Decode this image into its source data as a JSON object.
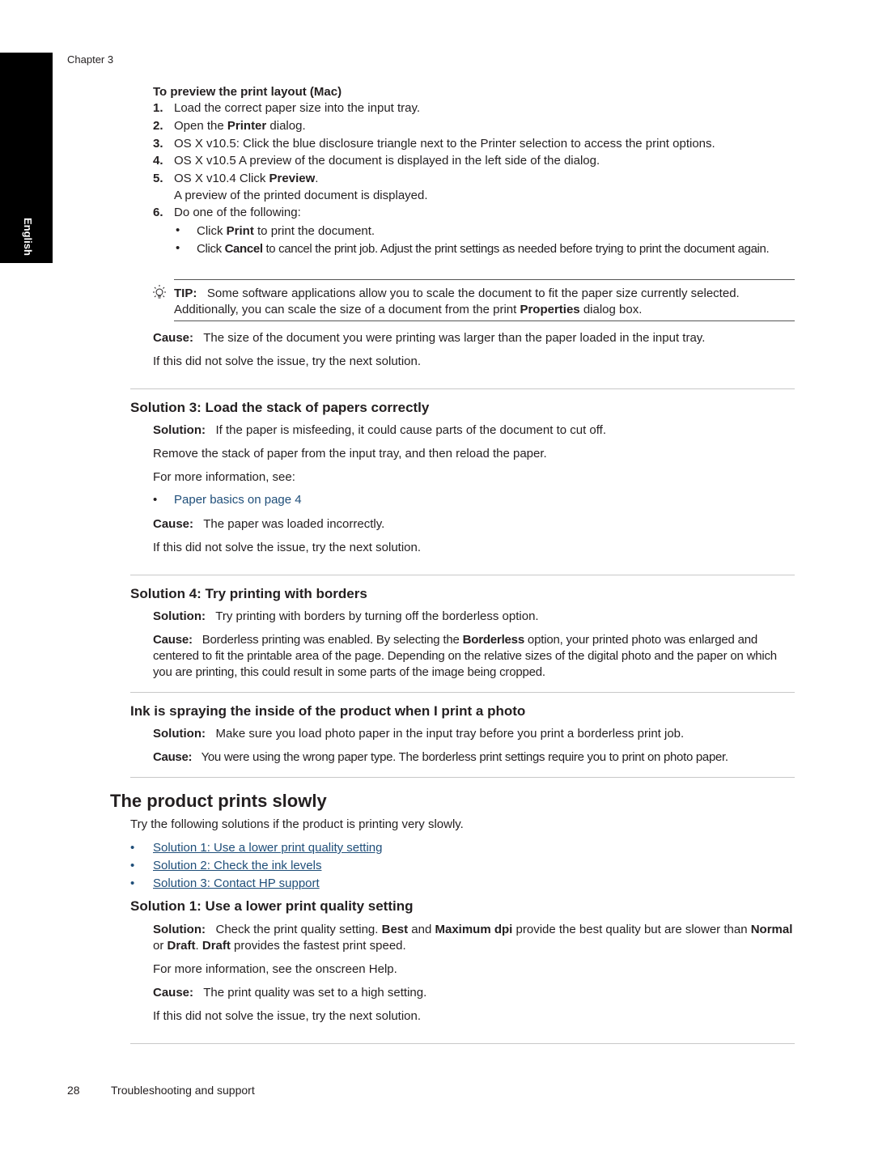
{
  "sidebar": {
    "language_tab": "English"
  },
  "header": {
    "chapter": "Chapter 3"
  },
  "mac_preview": {
    "title": "To preview the print layout (Mac)",
    "steps": [
      {
        "num": "1.",
        "pre": "Load the correct paper size into the input tray.",
        "bold": "",
        "post": ""
      },
      {
        "num": "2.",
        "pre": "Open the ",
        "bold": "Printer",
        "post": " dialog."
      },
      {
        "num": "3.",
        "pre": "OS X v10.5: Click the blue disclosure triangle next to the Printer selection to access the print options.",
        "bold": "",
        "post": ""
      },
      {
        "num": "4.",
        "pre": "OS X v10.5 A preview of the document is displayed in the left side of the dialog.",
        "bold": "",
        "post": ""
      },
      {
        "num": "5.",
        "pre": "OS X v10.4 Click ",
        "bold": "Preview",
        "post": "."
      },
      {
        "num": "6.",
        "pre": "Do one of the following:",
        "bold": "",
        "post": ""
      }
    ],
    "step5_note": "A preview of the printed document is displayed.",
    "bullets": [
      {
        "pre": "Click ",
        "bold": "Print",
        "post": " to print the document."
      },
      {
        "pre": "Click ",
        "bold": "Cancel",
        "post": " to cancel the print job. Adjust the print settings as needed before trying to print the document again."
      }
    ]
  },
  "tip": {
    "label": "TIP:",
    "text1": "Some software applications allow you to scale the document to fit the paper size currently selected. Additionally, you can scale the size of a document from the print ",
    "bold": "Properties",
    "text2": " dialog box."
  },
  "cause1": {
    "label": "Cause:",
    "text": "The size of the document you were printing was larger than the paper loaded in the input tray."
  },
  "next_solution": "If this did not solve the issue, try the next solution.",
  "solution3": {
    "heading": "Solution 3: Load the stack of papers correctly",
    "solution_label": "Solution:",
    "solution_text": "If the paper is misfeeding, it could cause parts of the document to cut off.",
    "para2": "Remove the stack of paper from the input tray, and then reload the paper.",
    "para3": "For more information, see:",
    "link": "Paper basics on page 4",
    "cause_label": "Cause:",
    "cause_text": "The paper was loaded incorrectly."
  },
  "solution4": {
    "heading": "Solution 4: Try printing with borders",
    "solution_label": "Solution:",
    "solution_text": "Try printing with borders by turning off the borderless option.",
    "cause_label": "Cause:",
    "cause_pre": "Borderless printing was enabled. By selecting the ",
    "cause_bold": "Borderless",
    "cause_post": " option, your printed photo was enlarged and centered to fit the printable area of the page. Depending on the relative sizes of the digital photo and the paper on which you are printing, this could result in some parts of the image being cropped."
  },
  "ink": {
    "heading": "Ink is spraying the inside of the product when I print a photo",
    "solution_label": "Solution:",
    "solution_text": "Make sure you load photo paper in the input tray before you print a borderless print job.",
    "cause_label": "Cause:",
    "cause_text": "You were using the wrong paper type. The borderless print settings require you to print on photo paper."
  },
  "slow": {
    "heading": "The product prints slowly",
    "intro": "Try the following solutions if the product is printing very slowly.",
    "links": [
      "Solution 1: Use a lower print quality setting",
      "Solution 2: Check the ink levels",
      "Solution 3: Contact HP support"
    ],
    "sol1_heading": "Solution 1: Use a lower print quality setting",
    "solution_label": "Solution:",
    "sol_parts": [
      "Check the print quality setting. ",
      "Best",
      " and ",
      "Maximum dpi",
      " provide the best quality but are slower than ",
      "Normal",
      " or ",
      "Draft",
      ". ",
      "Draft",
      " provides the fastest print speed."
    ],
    "more_info": "For more information, see the onscreen Help.",
    "cause_label": "Cause:",
    "cause_text": "The print quality was set to a high setting."
  },
  "footer": {
    "page_number": "28",
    "section": "Troubleshooting and support"
  }
}
